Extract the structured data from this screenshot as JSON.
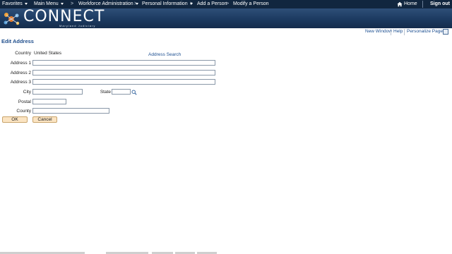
{
  "topnav": {
    "items": [
      {
        "label": "Favorites",
        "has_dropdown": true
      },
      {
        "label": "Main Menu",
        "has_dropdown": true
      },
      {
        "label": "Workforce Administration",
        "has_dropdown": true
      },
      {
        "label": "Personal Information",
        "has_dropdown": true
      },
      {
        "label": "Add a Person",
        "has_dropdown": false
      },
      {
        "label": "Modify a Person",
        "has_dropdown": false
      }
    ],
    "separator": ">",
    "home_label": "Home",
    "signout_label": "Sign out"
  },
  "banner": {
    "logo_text": "CONNECT",
    "logo_subtext": "Maryland Judiciary"
  },
  "toolbar": {
    "new_window": "New Window",
    "help": "Help",
    "personalize": "Personalize Page"
  },
  "page": {
    "title": "Edit Address"
  },
  "form": {
    "country_label": "Country",
    "country_value": "United States",
    "address_search_link": "Address Search",
    "address1_label": "Address 1",
    "address2_label": "Address 2",
    "address3_label": "Address 3",
    "city_label": "City",
    "state_label": "State",
    "postal_label": "Postal",
    "county_label": "County",
    "address1_value": "",
    "address2_value": "",
    "address3_value": "",
    "city_value": "",
    "state_value": "",
    "postal_value": "",
    "county_value": ""
  },
  "buttons": {
    "ok": "OK",
    "cancel": "Cancel"
  },
  "colors": {
    "nav_bg": "#11263f",
    "banner_bg": "#1c3a60",
    "title_color": "#1f4e8c",
    "link_color": "#1d4f91",
    "button_bg": "#fbe4c2"
  }
}
